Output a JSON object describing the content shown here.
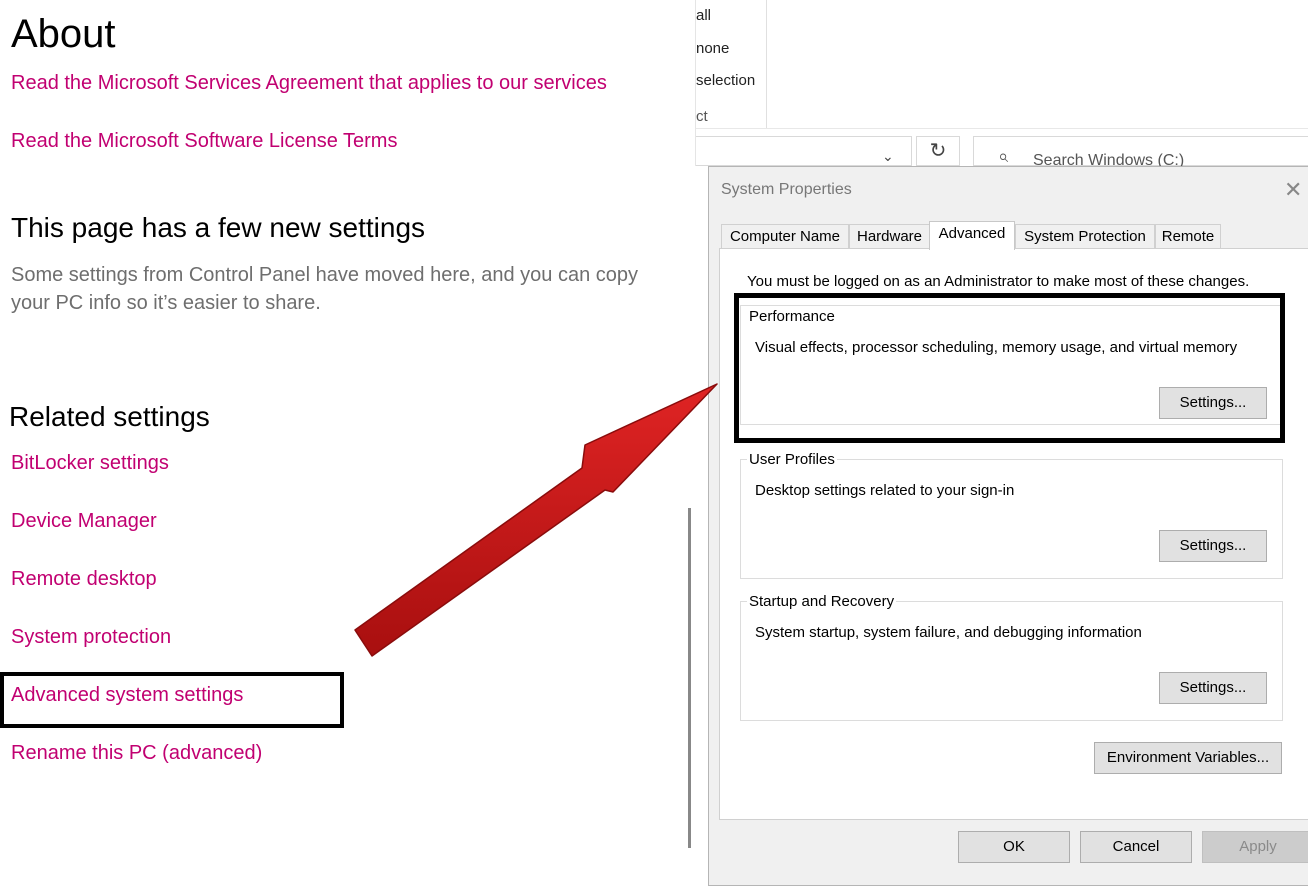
{
  "settings": {
    "page_title": "About",
    "links_top": [
      "Read the Microsoft Services Agreement that applies to our services",
      "Read the Microsoft Software License Terms"
    ],
    "new_settings_heading": "This page has a few new settings",
    "new_settings_desc": "Some settings from Control Panel have moved here, and you can copy your PC info so it’s easier to share.",
    "related_heading": "Related settings",
    "related_links": [
      "BitLocker settings",
      "Device Manager",
      "Remote desktop",
      "System protection",
      "Advanced system settings",
      "Rename this PC (advanced)"
    ]
  },
  "explorer": {
    "ribbon_items": [
      "all",
      "none",
      "selection",
      "ct"
    ],
    "search_placeholder": "Search Windows (C:)"
  },
  "dialog": {
    "title": "System Properties",
    "tabs": [
      "Computer Name",
      "Hardware",
      "Advanced",
      "System Protection",
      "Remote"
    ],
    "active_tab": "Advanced",
    "notice": "You must be logged on as an Administrator to make most of these changes.",
    "groups": [
      {
        "title": "Performance",
        "desc": "Visual effects, processor scheduling, memory usage, and virtual memory",
        "button": "Settings..."
      },
      {
        "title": "User Profiles",
        "desc": "Desktop settings related to your sign-in",
        "button": "Settings..."
      },
      {
        "title": "Startup and Recovery",
        "desc": "System startup, system failure, and debugging information",
        "button": "Settings..."
      }
    ],
    "env_button": "Environment Variables...",
    "ok": "OK",
    "cancel": "Cancel",
    "apply": "Apply"
  },
  "colors": {
    "link": "#c10071",
    "arrow": "#d11a1a",
    "highlight": "#000000"
  }
}
